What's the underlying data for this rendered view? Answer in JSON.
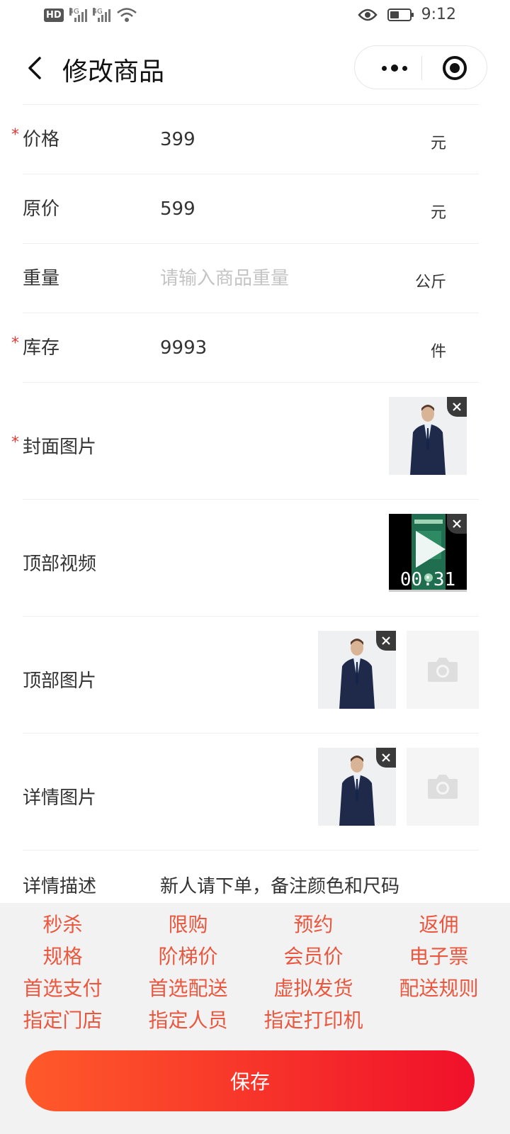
{
  "status_bar": {
    "hd": "HD",
    "net1": "4G",
    "net2": "4G",
    "time": "9:12"
  },
  "nav": {
    "title": "修改商品"
  },
  "form": {
    "price": {
      "label": "价格",
      "value": "399",
      "unit": "元",
      "required": "*"
    },
    "original_price": {
      "label": "原价",
      "value": "599",
      "unit": "元"
    },
    "weight": {
      "label": "重量",
      "value": "",
      "placeholder": "请输入商品重量",
      "unit": "公斤"
    },
    "stock": {
      "label": "库存",
      "value": "9993",
      "unit": "件",
      "required": "*"
    },
    "cover_image": {
      "label": "封面图片",
      "required": "*"
    },
    "top_video": {
      "label": "顶部视频",
      "duration": "00:31"
    },
    "top_images": {
      "label": "顶部图片"
    },
    "detail_images": {
      "label": "详情图片"
    },
    "description": {
      "label": "详情描述",
      "value": "新人请下单，备注颜色和尺码"
    }
  },
  "features": [
    "秒杀",
    "限购",
    "预约",
    "返佣",
    "规格",
    "阶梯价",
    "会员价",
    "电子票",
    "首选支付",
    "首选配送",
    "虚拟发货",
    "配送规则",
    "指定门店",
    "指定人员",
    "指定打印机"
  ],
  "save_label": "保存",
  "colors": {
    "accent": "#e9573f",
    "gradient_start": "#ff5a2a",
    "gradient_end": "#f0102a",
    "required": "#e53935"
  },
  "icons": {
    "back": "chevron-left-icon",
    "more": "more-dots-icon",
    "close_mini": "target-close-icon",
    "delete": "close-icon",
    "add_photo": "camera-icon",
    "play": "play-icon"
  }
}
